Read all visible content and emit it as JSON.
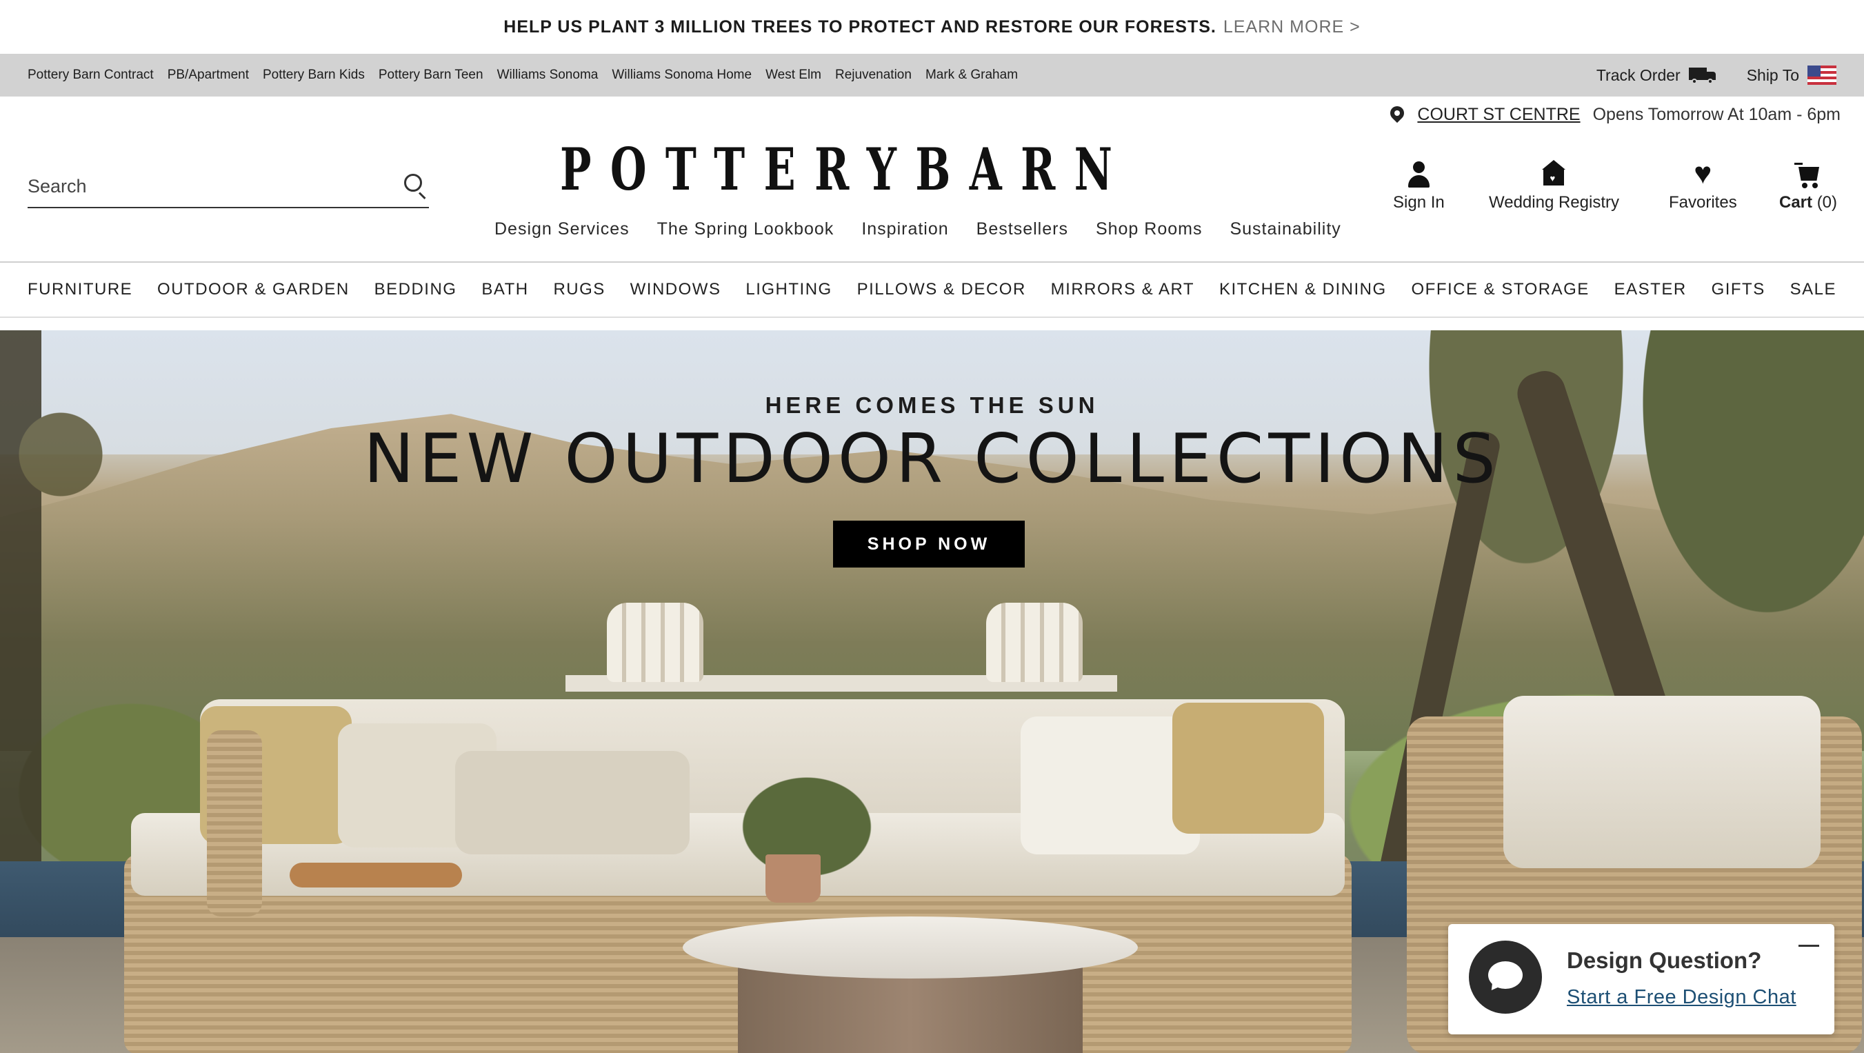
{
  "promo": {
    "message": "HELP US PLANT 3 MILLION TREES TO PROTECT AND RESTORE OUR FORESTS.",
    "link": "LEARN MORE >"
  },
  "brands": [
    "Pottery Barn Contract",
    "PB/Apartment",
    "Pottery Barn Kids",
    "Pottery Barn Teen",
    "Williams Sonoma",
    "Williams Sonoma Home",
    "West Elm",
    "Rejuvenation",
    "Mark & Graham"
  ],
  "utility": {
    "track_order": "Track Order",
    "ship_to": "Ship To",
    "truck_icon": "truck-icon",
    "flag_icon": "us-flag-icon"
  },
  "store": {
    "name": "COURT ST CENTRE",
    "hours": "Opens Tomorrow At 10am - 6pm"
  },
  "search": {
    "placeholder": "Search"
  },
  "logo": "POTTERYBARN",
  "subnav": [
    "Design Services",
    "The Spring Lookbook",
    "Inspiration",
    "Bestsellers",
    "Shop Rooms",
    "Sustainability"
  ],
  "account": {
    "sign_in": "Sign In",
    "registry": "Wedding Registry",
    "favorites": "Favorites",
    "cart": "Cart",
    "cart_count": "(0)"
  },
  "categories": [
    "FURNITURE",
    "OUTDOOR & GARDEN",
    "BEDDING",
    "BATH",
    "RUGS",
    "WINDOWS",
    "LIGHTING",
    "PILLOWS & DECOR",
    "MIRRORS & ART",
    "KITCHEN & DINING",
    "OFFICE & STORAGE",
    "EASTER",
    "GIFTS",
    "SALE"
  ],
  "hero": {
    "eyebrow": "HERE COMES THE SUN",
    "headline": "NEW OUTDOOR COLLECTIONS",
    "cta": "SHOP NOW"
  },
  "chat": {
    "title": "Design Question?",
    "link": "Start a Free Design Chat"
  }
}
